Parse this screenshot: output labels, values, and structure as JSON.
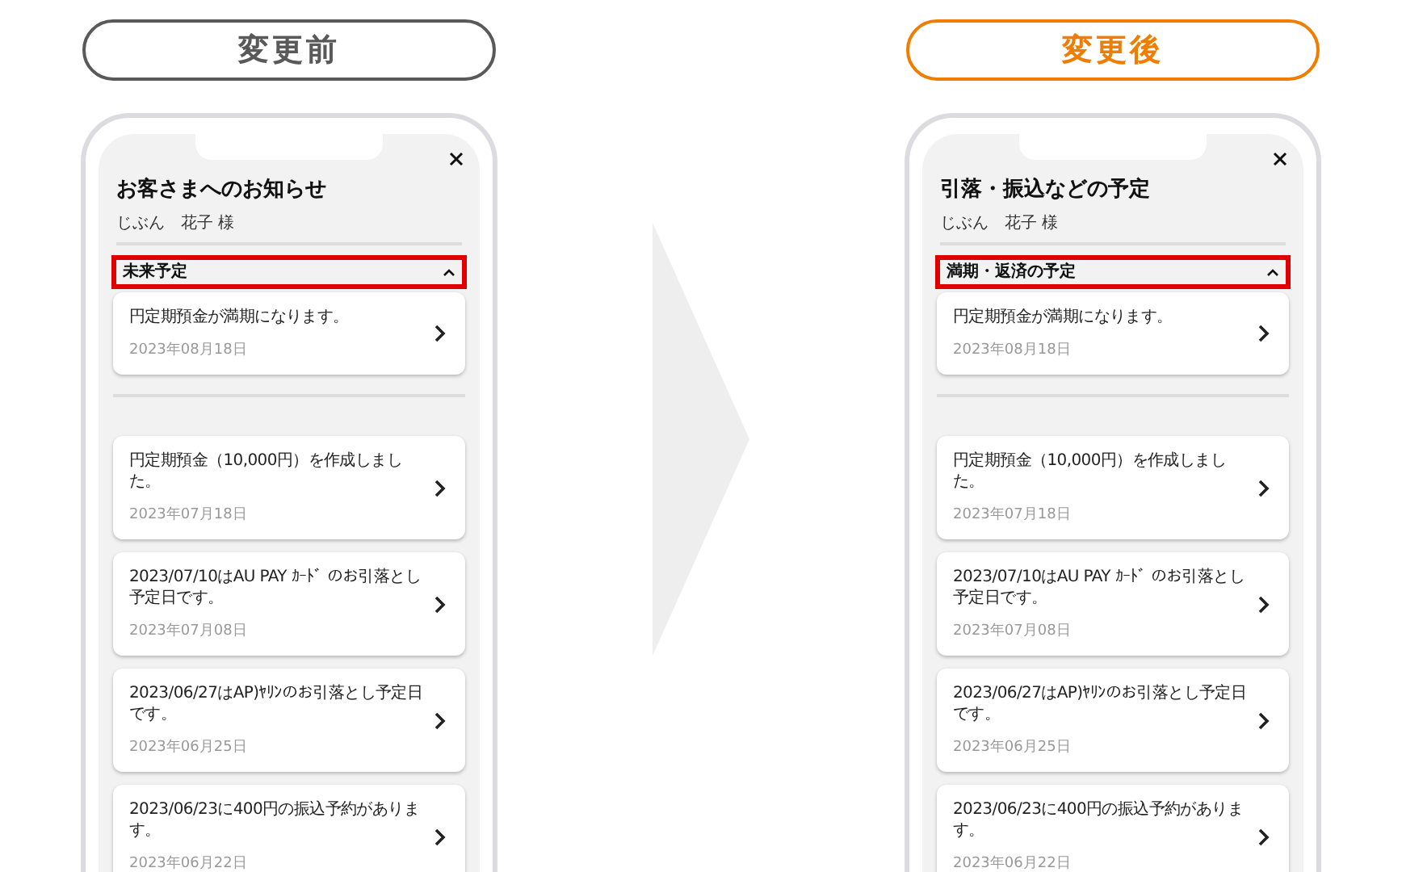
{
  "panels": [
    {
      "label": "変更前",
      "color": "#595959",
      "title": "お客さまへのお知らせ",
      "customer": "じぶん　花子 様",
      "section": {
        "title": "未来予定",
        "expanded": true,
        "highlighted": true
      },
      "upcoming": [
        {
          "message": "円定期預金が満期になります。",
          "date": "2023年08月18日"
        }
      ],
      "notices": [
        {
          "message": "円定期預金（10,000円）を作成しました。",
          "date": "2023年07月18日"
        },
        {
          "message": "2023/07/10はAU PAY ｶｰﾄﾞ のお引落とし予定日です。",
          "date": "2023年07月08日"
        },
        {
          "message": "2023/06/27はAP)ﾔﾘﾝのお引落とし予定日です。",
          "date": "2023年06月25日"
        },
        {
          "message": "2023/06/23に400円の振込予約があります。",
          "date": "2023年06月22日"
        }
      ]
    },
    {
      "label": "変更後",
      "color": "#ef7d00",
      "title": "引落・振込などの予定",
      "customer": "じぶん　花子 様",
      "section": {
        "title": "満期・返済の予定",
        "expanded": true,
        "highlighted": true
      },
      "upcoming": [
        {
          "message": "円定期預金が満期になります。",
          "date": "2023年08月18日"
        }
      ],
      "notices": [
        {
          "message": "円定期預金（10,000円）を作成しました。",
          "date": "2023年07月18日"
        },
        {
          "message": "2023/07/10はAU PAY ｶｰﾄﾞ のお引落とし予定日です。",
          "date": "2023年07月08日"
        },
        {
          "message": "2023/06/27はAP)ﾔﾘﾝのお引落とし予定日です。",
          "date": "2023年06月25日"
        },
        {
          "message": "2023/06/23に400円の振込予約があります。",
          "date": "2023年06月22日"
        }
      ]
    }
  ]
}
